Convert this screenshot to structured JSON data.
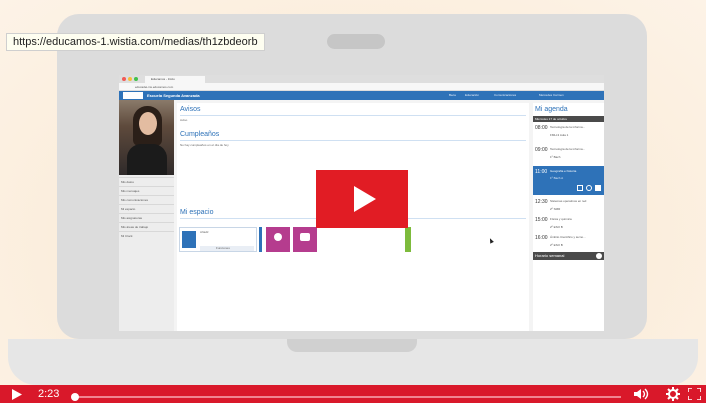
{
  "tooltip": {
    "url": "https://educamos-1.wistia.com/medias/th1zbdeorb"
  },
  "browser": {
    "tab_label": "Educamos - Inicio",
    "address": "educadei-ins.educamos.com"
  },
  "app": {
    "title": "Escuela Segunda Avanzada",
    "links": [
      "Beca",
      "Educación",
      "Comunicaciones"
    ],
    "user": "Mercedes Carmen"
  },
  "sidebar": {
    "items": [
      "Mis datos",
      "Mis mensajes",
      "Mis comunicaciones",
      "Mi espacio",
      "Mis asignaturas",
      "Mis áreas de trabajo",
      "Mi Clock"
    ]
  },
  "main": {
    "avisos_title": "Avisos",
    "avisos_text": "Aviso",
    "birthdays_title": "Cumpleaños",
    "birthdays_text": "No hay cumpleaños en el día de hoy",
    "space_title": "Mi espacio",
    "tile_text": "Añadir",
    "tile_caption": "Funciones"
  },
  "agenda": {
    "title": "Mi agenda",
    "date": "Miércoles 17 de octubre",
    "entries": [
      {
        "time": "08:00",
        "subject": "Tecnología de la informa...",
        "room": "FMH-3 Aula 1"
      },
      {
        "time": "09:00",
        "subject": "Tecnología de la informa...",
        "room": "1º Bach"
      },
      {
        "time": "11:00",
        "subject": "Geografía e historia",
        "room": "1º Bach A"
      },
      {
        "time": "12:30",
        "subject": "Sistemas operativos en red",
        "room": "2º SMR"
      },
      {
        "time": "15:00",
        "subject": "Física y química",
        "room": "2º ESO B"
      },
      {
        "time": "16:00",
        "subject": "Ámbito Científico y tecno...",
        "room": "2º ESO B"
      }
    ],
    "schedule_label": "Horario semanal"
  },
  "player": {
    "time": "2:23",
    "progress": 0.003
  },
  "colors": {
    "brand": "#2e72b8",
    "player": "#d9182a",
    "play": "#e11c24"
  },
  "icons": {
    "play": "play-icon",
    "volume": "volume-icon",
    "settings": "gear-icon",
    "fullscreen": "fullscreen-icon"
  }
}
